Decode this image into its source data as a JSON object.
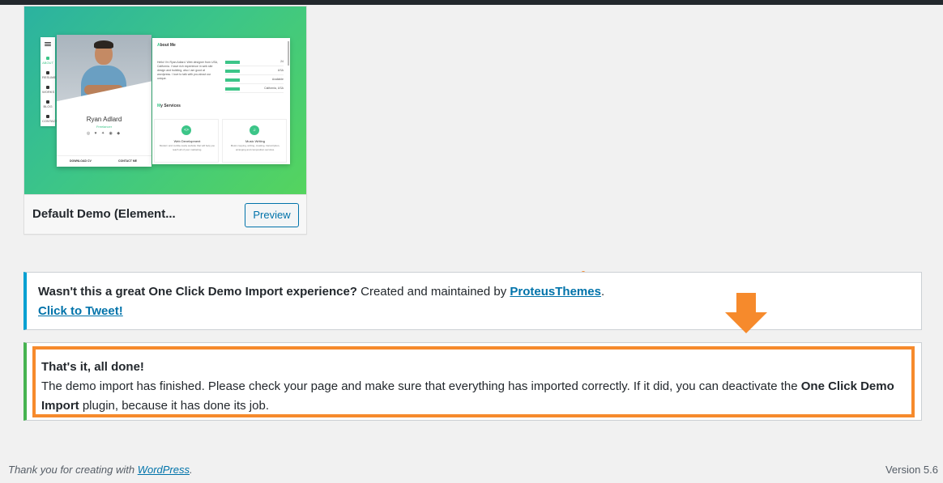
{
  "theme": {
    "name": "Default Demo (Element...",
    "preview_label": "Preview",
    "screenshot": {
      "nav_items": [
        "ABOUT",
        "RESUME",
        "WORKS",
        "BLOG",
        "CONTACT"
      ],
      "person_name": "Ryan Adlard",
      "person_role": "Freelancer",
      "social": "◎ ♥ ✦ ◉ ◆",
      "download_cv": "DOWNLOAD CV",
      "contact_me": "CONTACT ME",
      "about_title_first": "A",
      "about_title_rest": "bout Me",
      "about_text": "Hello! I'm Ryan Adlard. Web designer from USA, California. I have rich experience in web site design and building, also I am good at wordpress. I love to talk with you about our unique.",
      "info_rows": [
        {
          "value": "24"
        },
        {
          "value": "USA"
        },
        {
          "value": "Available"
        },
        {
          "value": "California, USA"
        }
      ],
      "services_title_first": "M",
      "services_title_rest": "y Services",
      "services": [
        {
          "title": "Web Development",
          "desc": "Modern and mobile-ready website that will help you reach all of your marketing."
        },
        {
          "title": "Music Writing",
          "desc": "Music copying, writing, creating, transcription, arranging and composition services."
        }
      ]
    }
  },
  "notice_info": {
    "bold_text": "Wasn't this a great One Click Demo Import experience?",
    "text": " Created and maintained by ",
    "link": "ProteusThemes",
    "end": ".",
    "tweet_link": "Click to Tweet!"
  },
  "notice_success": {
    "title": "That's it, all done!",
    "text_1": "The demo import has finished. Please check your page and make sure that everything has imported correctly. If it did, you can deactivate the ",
    "plugin_name": "One Click Demo Import",
    "text_2": " plugin, because it has done its job."
  },
  "footer": {
    "thanks_prefix": "Thank you for creating with ",
    "wp_link": "WordPress",
    "thanks_suffix": ".",
    "version": "Version 5.6"
  },
  "colors": {
    "info_accent": "#00a0d2",
    "success_accent": "#46b450",
    "highlight": "#f68a2c",
    "link": "#0073aa"
  }
}
